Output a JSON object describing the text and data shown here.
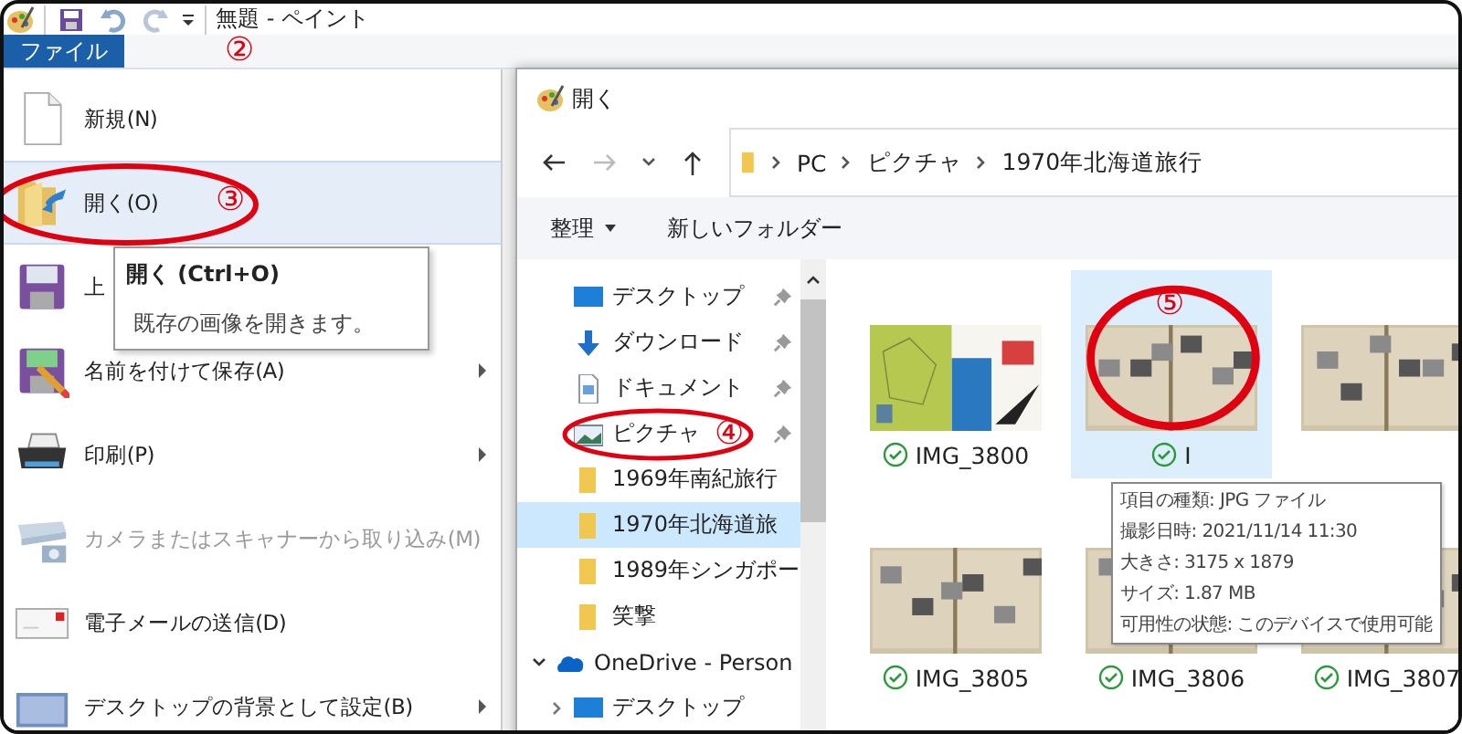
{
  "paint": {
    "title": "無題 - ペイント",
    "file_tab": {
      "label": "ファイル",
      "selected": true
    },
    "ribbon_annotation": "②",
    "menu": [
      {
        "label": "新規(N)",
        "kind": "new",
        "submenu": false,
        "disabled": false,
        "highlighted": false
      },
      {
        "label": "開く(O)",
        "kind": "open",
        "submenu": false,
        "disabled": false,
        "highlighted": true,
        "annotation": "③"
      },
      {
        "label": "上",
        "kind": "save",
        "submenu": false,
        "disabled": false,
        "highlighted": false
      },
      {
        "label": "名前を付けて保存(A)",
        "kind": "saveas",
        "submenu": true,
        "disabled": false,
        "highlighted": false
      },
      {
        "label": "印刷(P)",
        "kind": "print",
        "submenu": true,
        "disabled": false,
        "highlighted": false
      },
      {
        "label": "カメラまたはスキャナーから取り込み(M)",
        "kind": "scanner",
        "submenu": false,
        "disabled": true,
        "highlighted": false
      },
      {
        "label": "電子メールの送信(D)",
        "kind": "email",
        "submenu": false,
        "disabled": false,
        "highlighted": false
      },
      {
        "label": "デスクトップの背景として設定(B)",
        "kind": "desktop",
        "submenu": true,
        "disabled": false,
        "highlighted": false
      }
    ],
    "tooltip": {
      "title": "開く (Ctrl+O)",
      "text": "既存の画像を開きます。"
    }
  },
  "dialog": {
    "title": "開く",
    "address": [
      "PC",
      "ピクチャ",
      "1970年北海道旅行"
    ],
    "toolbar": [
      {
        "label": "整理",
        "dropdown": true
      },
      {
        "label": "新しいフォルダー",
        "dropdown": false
      }
    ],
    "nav": [
      {
        "label": "デスクトップ",
        "kind": "desktop",
        "pinned": true,
        "selected": false
      },
      {
        "label": "ダウンロード",
        "kind": "download",
        "pinned": true,
        "selected": false
      },
      {
        "label": "ドキュメント",
        "kind": "document",
        "pinned": true,
        "selected": false
      },
      {
        "label": "ピクチャ",
        "kind": "pictures",
        "pinned": true,
        "selected": false,
        "annotation": "④"
      },
      {
        "label": "1969年南紀旅行",
        "kind": "folder",
        "pinned": false,
        "selected": false
      },
      {
        "label": "1970年北海道旅",
        "kind": "folder",
        "pinned": false,
        "selected": true
      },
      {
        "label": "1989年シンガポー",
        "kind": "folder",
        "pinned": false,
        "selected": false
      },
      {
        "label": "笑撃",
        "kind": "folder",
        "pinned": false,
        "selected": false
      },
      {
        "label": "OneDrive - Person",
        "kind": "cloud",
        "pinned": false,
        "selected": false,
        "expanded": true,
        "children": [
          {
            "label": "デスクトップ",
            "kind": "desktop",
            "pinned": false,
            "selected": false,
            "expanded": false
          }
        ]
      }
    ],
    "files": [
      {
        "name": "IMG_3800",
        "kind": "map",
        "selected": false,
        "synced": true
      },
      {
        "name": "I",
        "kind": "album",
        "selected": true,
        "synced": true,
        "annotation": "⑤"
      },
      {
        "kind": "album",
        "selected": false
      },
      {
        "name": "IMG_3805",
        "kind": "album",
        "selected": false,
        "synced": true
      },
      {
        "name": "IMG_3806",
        "kind": "album",
        "selected": false,
        "synced": true
      },
      {
        "name": "IMG_3807",
        "kind": "album",
        "selected": false,
        "synced": true
      }
    ],
    "file_tooltip": [
      "項目の種類: JPG ファイル",
      "撮影日時: 2021/11/14 11:30",
      "大きさ: 3175 x 1879",
      "サイズ: 1.87 MB",
      "可用性の状態: このデバイスで使用可能"
    ]
  }
}
